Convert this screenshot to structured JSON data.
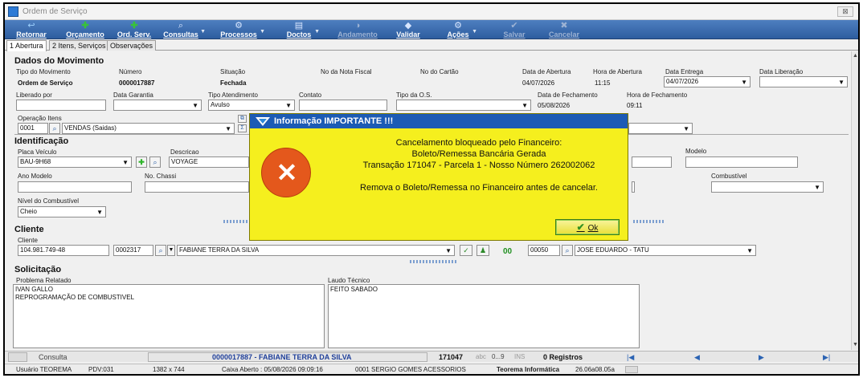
{
  "window": {
    "title": "Ordem de Serviço",
    "close_glyph": "⊠"
  },
  "toolbar": {
    "retornar": "Retornar",
    "orcamento": "Orçamento",
    "ord_serv": "Ord. Serv.",
    "consultas": "Consultas",
    "processos": "Processos",
    "doctos": "Doctos",
    "andamento": "Andamento",
    "validar": "Validar",
    "acoes": "Ações",
    "salvar": "Salvar",
    "cancelar": "Cancelar"
  },
  "tabs": [
    "1 Abertura",
    "2 Itens, Serviços",
    "Observações"
  ],
  "movimento": {
    "section_title": "Dados do Movimento",
    "tipo_label": "Tipo do Movimento",
    "tipo_value": "Ordem de Serviço",
    "numero_label": "Número",
    "numero_value": "0000017887",
    "situacao_label": "Situação",
    "situacao_value": "Fechada",
    "nota_label": "No da Nota Fiscal",
    "cartao_label": "No do Cartão",
    "data_abertura_label": "Data de Abertura",
    "data_abertura_value": "04/07/2026",
    "hora_abertura_label": "Hora de Abertura",
    "hora_abertura_value": "11:15",
    "data_entrega_label": "Data Entrega",
    "data_entrega_value": "04/07/2026",
    "data_liberacao_label": "Data Liberação",
    "liberado_label": "Liberado por",
    "garantia_label": "Data Garantia",
    "atendimento_label": "Tipo Atendimento",
    "atendimento_value": "Avulso",
    "contato_label": "Contato",
    "tipo_os_label": "Tipo da O.S.",
    "data_fechamento_label": "Data de Fechamento",
    "data_fechamento_value": "05/08/2026",
    "hora_fechamento_label": "Hora de Fechamento",
    "hora_fechamento_value": "09:11",
    "operacao_label": "Operação Itens",
    "operacao_code": "0001",
    "operacao_value": "VENDAS (Saidas)"
  },
  "identificacao": {
    "section_title": "Identificação",
    "placa_label": "Placa Veículo",
    "placa_value": "BAU-9H68",
    "descricao_label": "Descricao",
    "descricao_value": "VOYAGE",
    "modelo_label": "Modelo",
    "ano_label": "Ano Modelo",
    "chassi_label": "No. Chassi",
    "combustivel_label": "Combustível",
    "nivel_label": "Nível do Combustível",
    "nivel_value": "Cheio"
  },
  "cliente": {
    "section_title": "Cliente",
    "cliente_label": "Cliente",
    "cpf_value": "104.981.749-48",
    "codigo_value": "0002317",
    "nome_value": "FABIANE TERRA DA SILVA",
    "situacao_value": "00",
    "vendedor_code": "00050",
    "vendedor_name": "JOSE EDUARDO - TATU"
  },
  "solicitacao": {
    "section_title": "Solicitação",
    "problema_label": "Problema Relatado",
    "problema_text": "IVAN GALLO\nREPROGRAMAÇÃO DE COMBUSTIVEL",
    "laudo_label": "Laudo Técnico",
    "laudo_text": "FEITO SABADO"
  },
  "dialog": {
    "title": "Informação IMPORTANTE !!!",
    "line1": "Cancelamento bloqueado pelo Financeiro:",
    "line2": "Boleto/Remessa Bancária Gerada",
    "line3": "Transação 171047 - Parcela 1 - Nosso Número 262002062",
    "line4": "Remova o Boleto/Remessa no Financeiro antes de cancelar.",
    "ok_label": "Ok"
  },
  "statusbar": {
    "consulta_label": "Consulta",
    "record_text": "0000017887 - FABIANE TERRA DA SILVA",
    "transacao": "171047",
    "abc": "abc",
    "range": "0...9",
    "ins": "INS",
    "registros": "0 Registros"
  },
  "footer": {
    "usuario": "Usuário TEOREMA",
    "pdv": "PDV:031",
    "resolucao": "1382 x 744",
    "caixa": "Caixa Aberto : 05/08/2026 09:09:16",
    "empresa": "0001 SERGIO GOMES ACESSORIOS",
    "teorema": "Teorema Informática",
    "versao": "26.06a08.05a"
  },
  "colors": {
    "toolbar": "#2d5d9f",
    "dialog_bg": "#f5ef1e",
    "dialog_title": "#1c5bb4",
    "error_icon": "#e4581c",
    "record_text": "#1f3f9a"
  }
}
